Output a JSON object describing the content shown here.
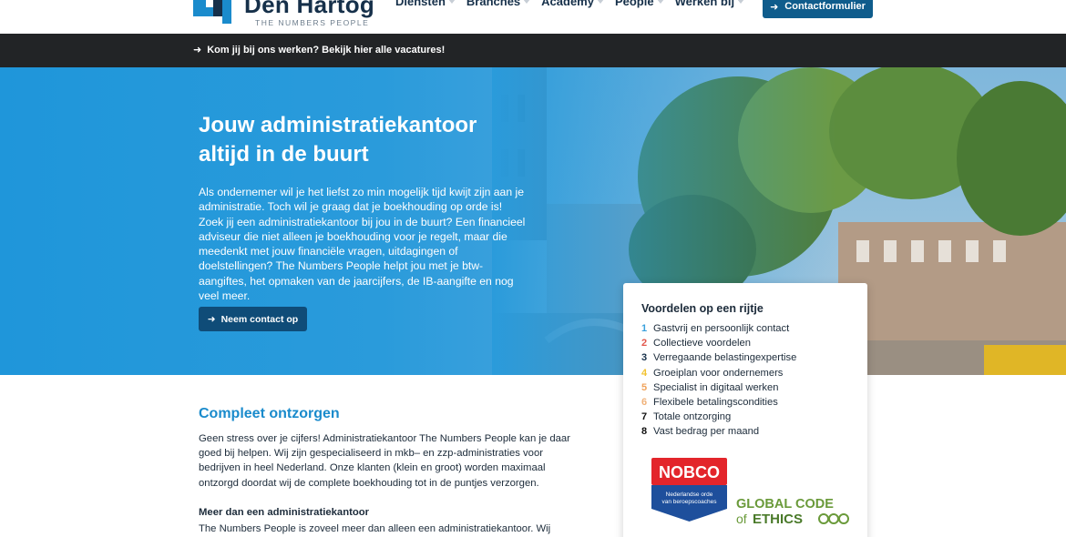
{
  "header": {
    "logo_name": "Den Hartog",
    "logo_tagline": "THE NUMBERS PEOPLE",
    "nav": [
      {
        "label": "Diensten"
      },
      {
        "label": "Branches"
      },
      {
        "label": "Academy"
      },
      {
        "label": "People"
      },
      {
        "label": "Werken bij"
      }
    ],
    "contact_button": "Contactformulier"
  },
  "topbar": {
    "link_text": "Kom jij bij ons werken? Bekijk hier alle vacatures!"
  },
  "hero": {
    "title": "Jouw administratiekantoor altijd in de buurt",
    "text": "Als ondernemer wil je het liefst zo min mogelijk tijd kwijt zijn aan je administratie. Toch wil je graag dat je boekhouding op orde is! Zoek jij een administratiekantoor bij jou in de buurt? Een financieel adviseur die niet alleen je boekhouding voor je regelt, maar die meedenkt met jouw financiële vragen, uitdagingen of doelstellingen? The Numbers People helpt jou met je btw-aangiftes, het opmaken van de jaarcijfers, de IB-aangifte en nog veel meer.",
    "button": "Neem contact op"
  },
  "card": {
    "title": "Voordelen op een rijtje",
    "items": [
      {
        "num": "1",
        "label": "Gastvrij en persoonlijk contact",
        "color": "#3aa0dc"
      },
      {
        "num": "2",
        "label": "Collectieve voordelen",
        "color": "#e2574c"
      },
      {
        "num": "3",
        "label": "Verregaande belastingexpertise",
        "color": "#16304a"
      },
      {
        "num": "4",
        "label": "Groeiplan voor ondernemers",
        "color": "#f2c230"
      },
      {
        "num": "5",
        "label": "Specialist in digitaal werken",
        "color": "#f0a35c"
      },
      {
        "num": "6",
        "label": "Flexibele betalingscondities",
        "color": "#f0b27a"
      },
      {
        "num": "7",
        "label": "Totale ontzorging",
        "color": "#111111"
      },
      {
        "num": "8",
        "label": "Vast bedrag per maand",
        "color": "#111111"
      }
    ],
    "nobco_title": "NOBCO",
    "nobco_sub1": "Nederlandse orde",
    "nobco_sub2": "van beroepscoaches",
    "ethics_line1": "GLOBAL CODE",
    "ethics_of": "of",
    "ethics_line2": "ETHICS"
  },
  "content": {
    "title": "Compleet ontzorgen",
    "text": "Geen stress over je cijfers! Administratiekantoor The Numbers People kan je daar goed bij helpen. Wij zijn gespecialiseerd in mkb– en zzp-administraties voor bedrijven in heel Nederland. Onze klanten (klein en groot) worden maximaal ontzorgd doordat wij de complete boekhouding tot in de puntjes verzorgen.",
    "subtitle": "Meer dan een administratiekantoor",
    "text2": "The Numbers People is zoveel meer dan alleen een administratiekantoor. Wij denken met"
  }
}
